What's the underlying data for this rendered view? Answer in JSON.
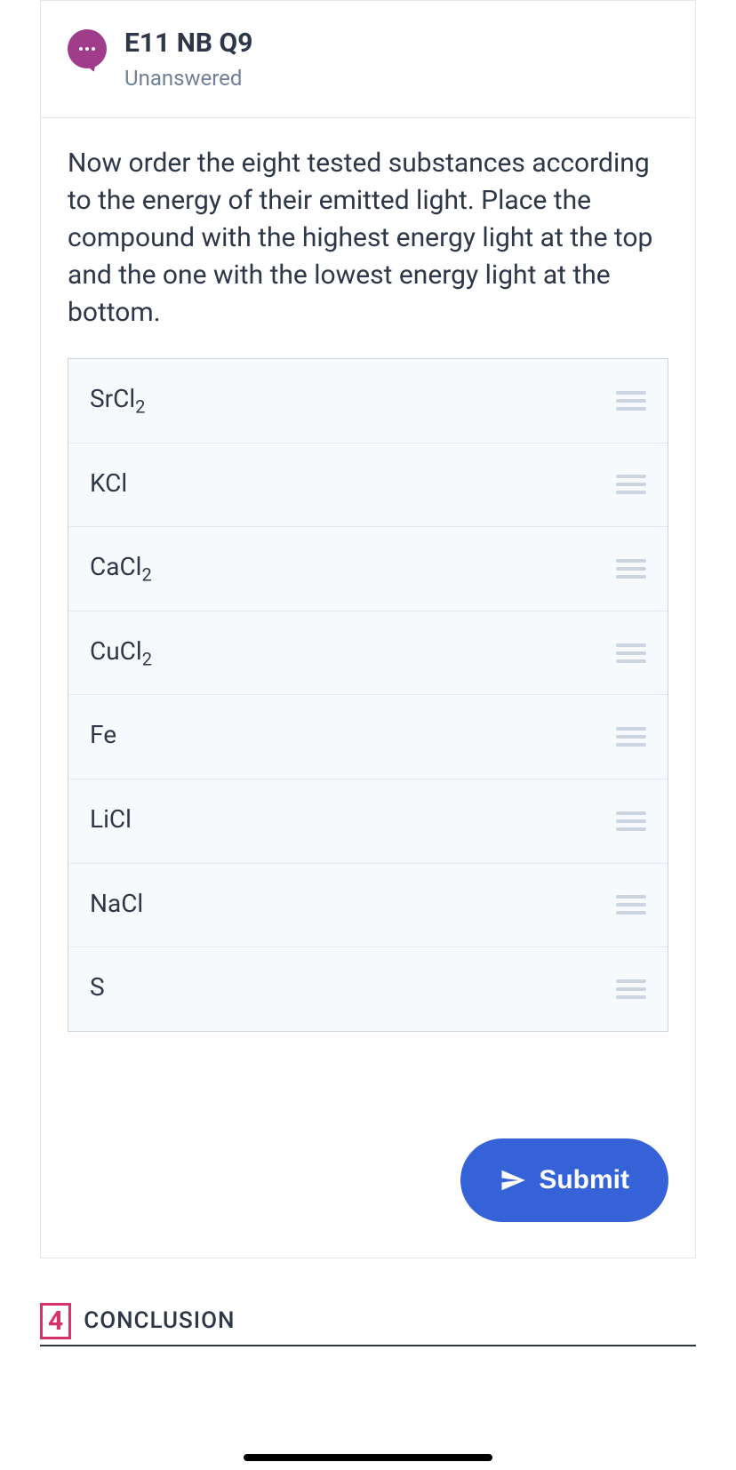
{
  "question": {
    "title": "E11 NB Q9",
    "status": "Unanswered",
    "prompt": "Now order the eight tested substances according to the energy of their emitted light. Place the compound with the highest energy light at the top and the one with the lowest energy light at the bottom."
  },
  "items": [
    {
      "label": "SrCl",
      "subscript": "2"
    },
    {
      "label": "KCl",
      "subscript": ""
    },
    {
      "label": "CaCl",
      "subscript": "2"
    },
    {
      "label": "CuCl",
      "subscript": "2"
    },
    {
      "label": "Fe",
      "subscript": ""
    },
    {
      "label": "LiCl",
      "subscript": ""
    },
    {
      "label": "NaCl",
      "subscript": ""
    },
    {
      "label": "S",
      "subscript": ""
    }
  ],
  "submit": {
    "label": "Submit"
  },
  "section": {
    "number": "4",
    "title": "CONCLUSION"
  }
}
